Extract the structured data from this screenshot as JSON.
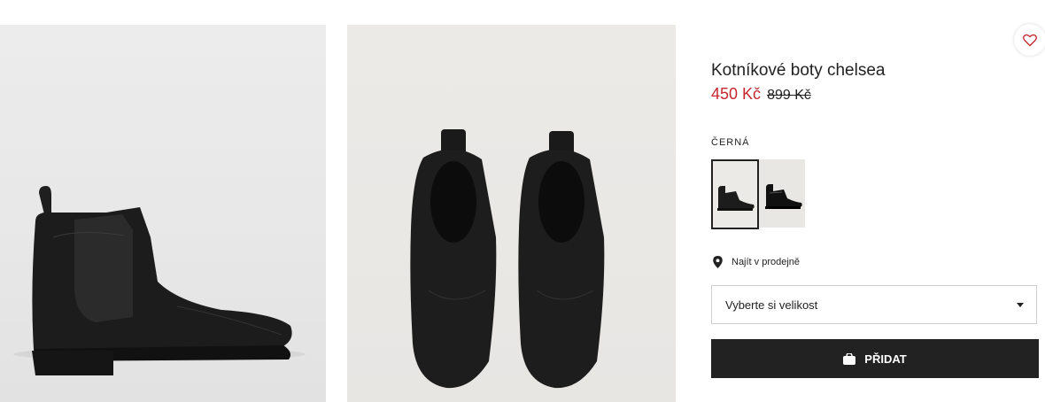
{
  "product": {
    "title": "Kotníkové boty chelsea",
    "sale_price": "450 Kč",
    "original_price": "899 Kč",
    "color_label": "ČERNÁ",
    "store_link": "Najít v prodejně",
    "size_placeholder": "Vyberte si velikost",
    "add_label": "PŘIDAT"
  },
  "icons": {
    "favorite": "heart-icon",
    "store": "location-pin-icon",
    "dropdown": "caret-down-icon",
    "add": "shopping-bag-icon"
  },
  "colors": {
    "sale_price": "#c7262f",
    "add_button_bg": "#222222",
    "heart": "#c7262f",
    "selected_swatch_border": "#222222"
  }
}
